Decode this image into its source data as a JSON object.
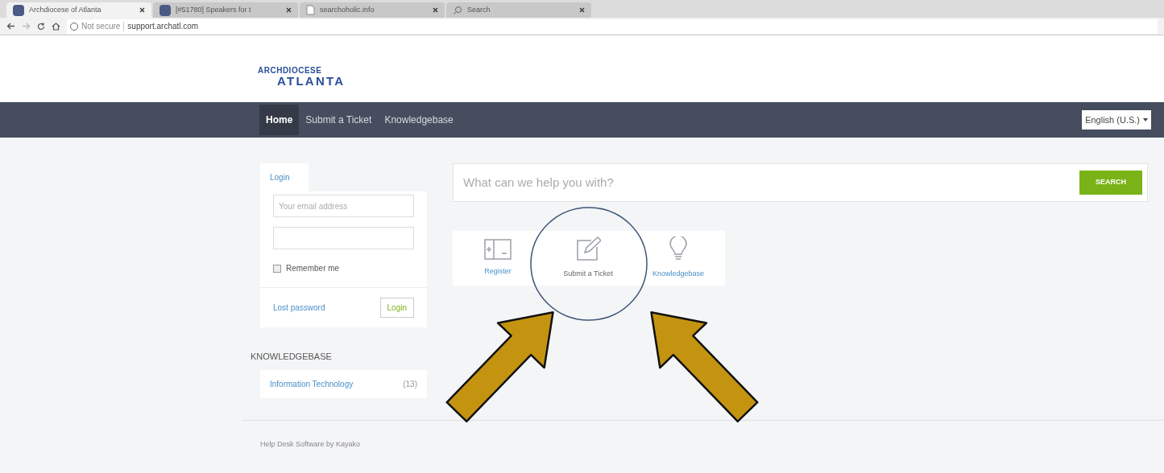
{
  "browser": {
    "tabs": [
      {
        "title": "Archdiocese of Atlanta",
        "selected": true,
        "kind": "logo"
      },
      {
        "title": "[#51780] Speakers for t",
        "selected": false,
        "kind": "logo"
      },
      {
        "title": "searchoholic.info",
        "selected": false,
        "kind": "page"
      },
      {
        "title": "Search",
        "selected": false,
        "kind": "search"
      }
    ],
    "security": "Not secure",
    "url": "support.archatl.com"
  },
  "logo": {
    "line_1": "ARCHDIOCESE",
    "line_2": "ATLANTA"
  },
  "nav": {
    "items": [
      {
        "label": "Home",
        "selected": true
      },
      {
        "label": "Submit a Ticket",
        "selected": false
      },
      {
        "label": "Knowledgebase",
        "selected": false
      }
    ],
    "language": "English (U.S.)"
  },
  "login": {
    "tab": "Login",
    "email_placeholder": "Your email address",
    "remember": {
      "label": "Remember me",
      "checked": false
    },
    "lost_password": "Lost password",
    "button": "Login"
  },
  "knowledgebase": {
    "heading": "KNOWLEDGEBASE",
    "categories": [
      {
        "name": "Information Technology",
        "count": "(13)"
      }
    ]
  },
  "search": {
    "placeholder": "What can we help you with?",
    "button": "SEARCH"
  },
  "actions": [
    {
      "label": "Register",
      "kind": "register",
      "highlighted": false
    },
    {
      "label": "Submit a Ticket",
      "kind": "ticket",
      "highlighted": true
    },
    {
      "label": "Knowledgebase",
      "kind": "bulb",
      "highlighted": false
    }
  ],
  "footer": {
    "text": "Help Desk Software by Kayako"
  }
}
